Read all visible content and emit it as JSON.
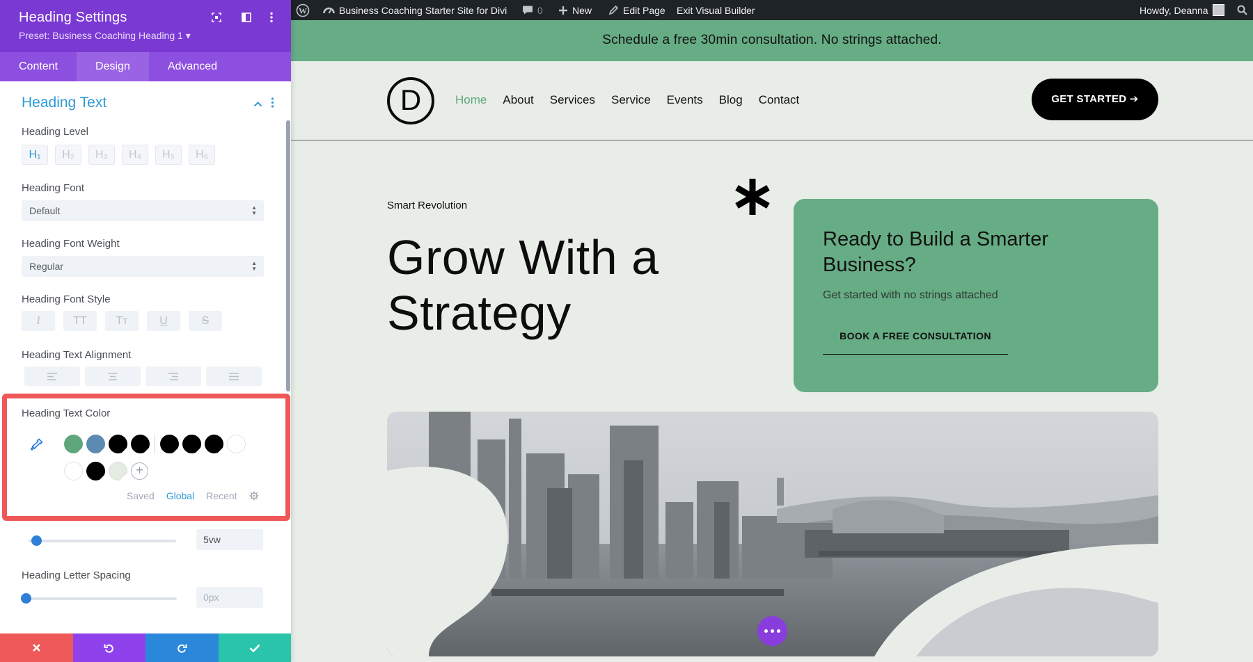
{
  "panel": {
    "title": "Heading Settings",
    "preset": "Preset: Business Coaching Heading 1 ▾",
    "tabs": [
      {
        "label": "Content",
        "active": false
      },
      {
        "label": "Design",
        "active": true
      },
      {
        "label": "Advanced",
        "active": false
      }
    ],
    "section_title": "Heading Text",
    "heading_level": {
      "label": "Heading Level",
      "options": [
        "H₁",
        "H₂",
        "H₃",
        "H₄",
        "H₅",
        "H₆"
      ],
      "selected": "H₁"
    },
    "heading_font": {
      "label": "Heading Font",
      "value": "Default"
    },
    "heading_font_weight": {
      "label": "Heading Font Weight",
      "value": "Regular"
    },
    "heading_font_style": {
      "label": "Heading Font Style",
      "options": [
        "I",
        "TT",
        "Tт",
        "U",
        "S"
      ]
    },
    "heading_text_alignment": {
      "label": "Heading Text Alignment",
      "options": [
        "left",
        "center",
        "right",
        "justify"
      ]
    },
    "heading_text_color": {
      "label": "Heading Text Color",
      "swatches_row1": [
        "#5fa67c",
        "#5c8bb2",
        "#000000",
        "#000000",
        "#000000",
        "#000000",
        "#000000",
        "#ffffff"
      ],
      "swatches_row2": [
        "#ffffff",
        "#000000",
        "#e4ebe2"
      ],
      "palette_tabs": [
        {
          "label": "Saved",
          "active": false
        },
        {
          "label": "Global",
          "active": true
        },
        {
          "label": "Recent",
          "active": false
        }
      ]
    },
    "heading_text_size": {
      "value": "5vw",
      "fraction": 0.05
    },
    "heading_letter_spacing": {
      "label": "Heading Letter Spacing",
      "value": "0px",
      "fraction": 0.0
    },
    "bottom_actions": [
      "close",
      "undo",
      "redo",
      "save"
    ],
    "colors": {
      "header": "#7b39d4",
      "accent": "#2e9bd6",
      "danger": "#ef5858",
      "save": "#29c4a9",
      "redo": "#2b87da",
      "undo": "#8f42ec"
    }
  },
  "adminbar": {
    "site_name": "Business Coaching Starter Site for Divi",
    "comments": "0",
    "new": "New",
    "edit_page": "Edit Page",
    "exit": "Exit Visual Builder",
    "howdy": "Howdy, Deanna"
  },
  "site": {
    "banner": "Schedule a free 30min consultation. No strings attached.",
    "logo_letter": "D",
    "nav": [
      {
        "label": "Home",
        "active": true
      },
      {
        "label": "About",
        "active": false
      },
      {
        "label": "Services",
        "active": false
      },
      {
        "label": "Service",
        "active": false
      },
      {
        "label": "Events",
        "active": false
      },
      {
        "label": "Blog",
        "active": false
      },
      {
        "label": "Contact",
        "active": false
      }
    ],
    "cta": "GET STARTED ➔",
    "hero": {
      "eyebrow": "Smart Revolution",
      "title": "Grow With a Strategy"
    },
    "card": {
      "title": "Ready to Build a Smarter Business?",
      "subtitle": "Get started with no strings attached",
      "button": "BOOK A FREE CONSULTATION"
    }
  }
}
